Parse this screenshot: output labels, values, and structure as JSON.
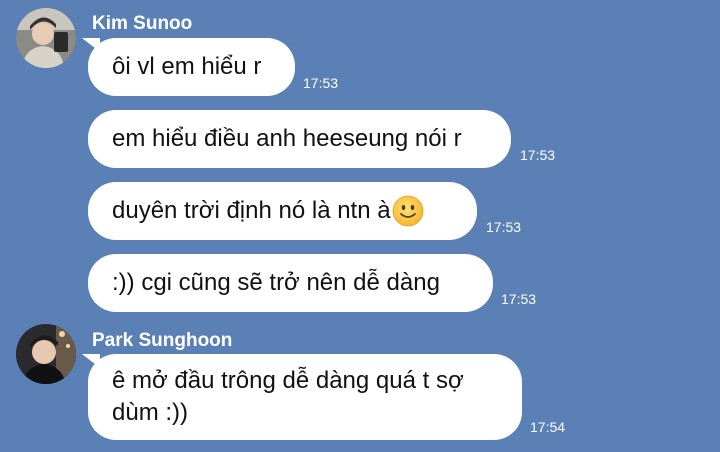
{
  "messages": [
    {
      "sender": "Kim Sunoo",
      "avatar": "avatar-kim-sunoo",
      "bubbles": [
        {
          "text": "ôi vl em hiểu r",
          "time": "17:53"
        },
        {
          "text": "em hiểu điều anh heeseung nói r",
          "time": "17:53"
        },
        {
          "text": "duyên trời định nó là ntn à",
          "emoji": "slightly-smiling-face-icon",
          "time": "17:53"
        },
        {
          "text": ":)) cgi cũng sẽ trở nên dễ dàng",
          "time": "17:53"
        }
      ]
    },
    {
      "sender": "Park Sunghoon",
      "avatar": "avatar-park-sunghoon",
      "bubbles": [
        {
          "text_line1": "ê mở đầu trông dễ dàng quá t sợ",
          "text_line2": "dùm :))",
          "time": "17:54"
        }
      ]
    }
  ],
  "colors": {
    "background": "#5b80b5",
    "bubble": "#ffffff",
    "text": "#111111",
    "meta_text": "#ffffff"
  }
}
